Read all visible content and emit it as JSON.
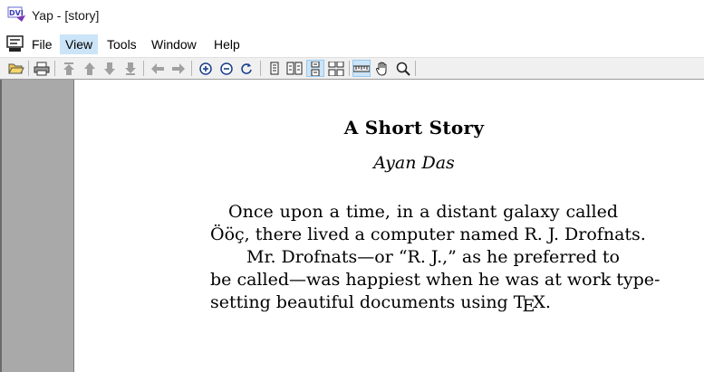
{
  "window": {
    "title": "Yap - [story]",
    "app_icon": "yap-dvi-icon"
  },
  "menubar": {
    "items": [
      {
        "label": "File",
        "active": false
      },
      {
        "label": "View",
        "active": true
      },
      {
        "label": "Tools",
        "active": false
      },
      {
        "label": "Window",
        "active": false
      },
      {
        "label": "Help",
        "active": false
      }
    ]
  },
  "toolbar": {
    "buttons": [
      "open-folder-icon",
      "print-icon",
      "first-page-icon",
      "previous-page-icon",
      "next-page-icon",
      "last-page-icon",
      "back-icon",
      "forward-icon",
      "zoom-in-icon",
      "zoom-out-icon",
      "refresh-icon",
      "single-page-icon",
      "double-page-icon",
      "continuous-page-icon",
      "continuous-double-page-icon",
      "ruler-icon",
      "hand-tool-icon",
      "magnifier-icon"
    ],
    "pressed": [
      "continuous-page-icon",
      "ruler-icon"
    ]
  },
  "colors": {
    "gutter": "#a9a9a9",
    "menu_highlight": "#cce4f7",
    "toolbar_bg": "#f0f0f0"
  },
  "document": {
    "title": "A Short Story",
    "author": "Ayan Das",
    "lines": {
      "l1": "Once upon a time, in a distant galaxy called",
      "l2": "Ööç, there lived a computer named R. J. Drofnats.",
      "l3": "Mr. Drofnats—or “R. J.,” as he preferred to",
      "l4": "be called—was happiest when he was at work type-",
      "l5_before": "setting beautiful documents using ",
      "tex_t": "T",
      "tex_e": "E",
      "tex_x": "X",
      "l5_after": "."
    }
  }
}
